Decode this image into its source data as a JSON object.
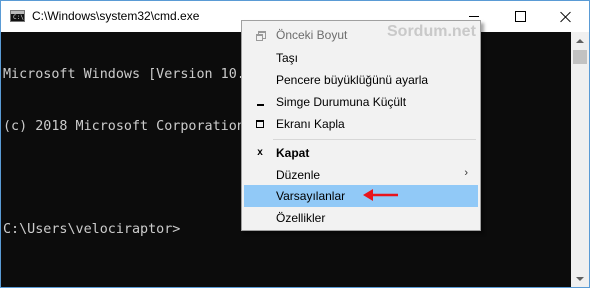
{
  "window": {
    "title": "C:\\Windows\\system32\\cmd.exe",
    "icon": "cmd-icon",
    "icon_prompt": "C:\\",
    "controls": [
      "minimize-icon",
      "maximize-icon",
      "close-icon"
    ]
  },
  "console": {
    "lines": [
      "Microsoft Windows [Version 10.",
      "(c) 2018 Microsoft Corporation",
      "",
      "C:\\Users\\velociraptor>"
    ],
    "text_color": "#cccccc",
    "background": "#0c0c0c"
  },
  "menu": {
    "items": [
      {
        "label": "Önceki Boyut",
        "glyph": "restore-icon",
        "disabled": true
      },
      {
        "label": "Taşı"
      },
      {
        "label": "Pencere büyüklüğünü ayarla"
      },
      {
        "label": "Simge Durumuna Küçült",
        "glyph": "minimize-icon"
      },
      {
        "label": "Ekranı Kapla",
        "glyph": "maximize-icon"
      },
      {
        "label": "Kapat",
        "glyph": "close-icon",
        "glyph_text": "x",
        "bold": true
      },
      {
        "label": "Düzenle",
        "submenu_arrow": "›"
      },
      {
        "label": "Varsayılanlar",
        "highlighted": true
      },
      {
        "label": "Özellikler"
      }
    ],
    "highlight_color": "#91c9f7"
  },
  "watermark": "Sordum.net",
  "annotation": {
    "icon": "red-arrow-icon",
    "color": "#e8141c"
  }
}
